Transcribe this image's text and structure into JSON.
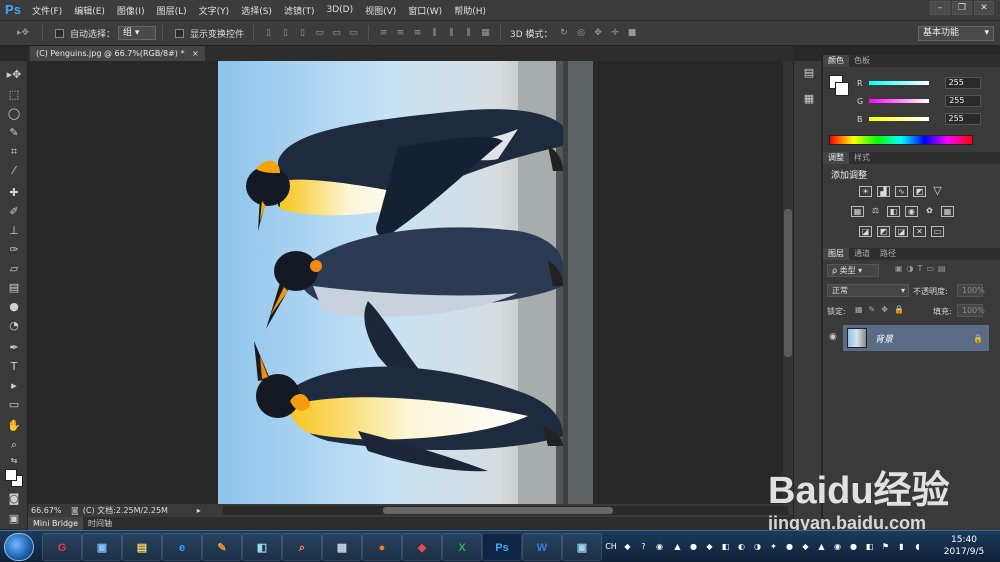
{
  "app": {
    "logo": "Ps",
    "menu": [
      "文件(F)",
      "编辑(E)",
      "图像(I)",
      "图层(L)",
      "文字(Y)",
      "选择(S)",
      "滤镜(T)",
      "3D(D)",
      "视图(V)",
      "窗口(W)",
      "帮助(H)"
    ]
  },
  "options_bar": {
    "auto_select_label": "自动选择：",
    "auto_select_value": "组",
    "show_transform_label": "显示变换控件",
    "mode_3d_label": "3D 模式：",
    "workspace": "基本功能"
  },
  "document": {
    "tab_title": "(C) Penguins.jpg @ 66.7%(RGB/8#) *",
    "zoom": "66.67%",
    "doc_info": "(C) 文档:2.25M/2.25M"
  },
  "bottom_tabs": [
    "Mini Bridge",
    "时间轴"
  ],
  "color_panel": {
    "tabs": [
      "颜色",
      "色板"
    ],
    "channels": [
      {
        "label": "R",
        "value": "255",
        "color": "#ff6a6a"
      },
      {
        "label": "G",
        "value": "255",
        "color": "#d97dff"
      },
      {
        "label": "B",
        "value": "255",
        "color": "#ffff66"
      }
    ]
  },
  "adjust_panel": {
    "tabs": [
      "调整",
      "样式"
    ],
    "title": "添加调整"
  },
  "layers_panel": {
    "tabs": [
      "图层",
      "通道",
      "路径"
    ],
    "filter_label": "ρ 类型",
    "blend_mode": "正常",
    "opacity_label": "不透明度:",
    "opacity_value": "100%",
    "lock_label": "锁定:",
    "fill_label": "填充:",
    "fill_value": "100%",
    "layer_name": "背景"
  },
  "taskbar": {
    "lang": "CH",
    "time": "15:40",
    "date": "2017/9/5"
  },
  "watermark": {
    "brand": "Baidu经验",
    "url": "jingyan.baidu.com"
  }
}
